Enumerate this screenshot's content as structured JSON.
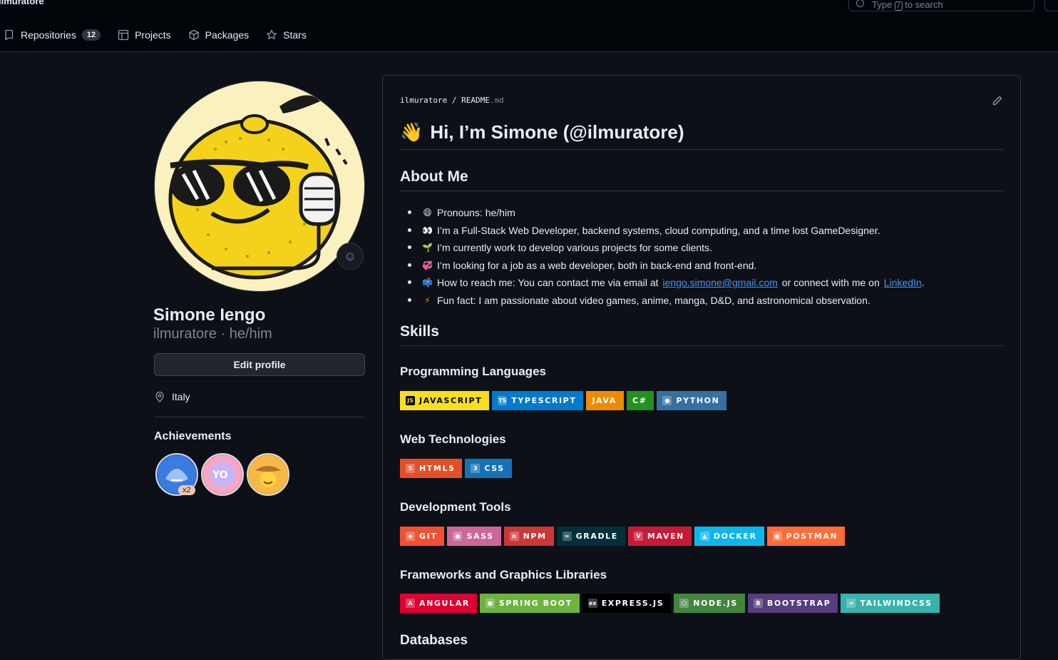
{
  "header": {
    "owner": "ilmuratore",
    "search_text": "Type / to search",
    "search_prefix": "Type",
    "search_key": "/",
    "search_suffix": "to search"
  },
  "nav": {
    "repositories": "Repositories",
    "repositories_count": "12",
    "projects": "Projects",
    "packages": "Packages",
    "stars": "Stars"
  },
  "profile": {
    "name": "Simone Iengo",
    "login_line": "ilmuratore · he/him",
    "edit_label": "Edit profile",
    "location": "Italy",
    "achievements_title": "Achievements",
    "achievement_count": "x2"
  },
  "readme": {
    "crumb_user": "ilmuratore",
    "crumb_sep": "/",
    "crumb_file": "README",
    "crumb_ext": ".md",
    "heading_emoji": "👋",
    "heading": "Hi, I’m Simone (@ilmuratore)",
    "about_title": "About Me",
    "about": [
      {
        "emoji": "😄",
        "text": "Pronouns: he/him"
      },
      {
        "emoji": "👀",
        "text": "I’m a Full-Stack Web Developer, backend systems, cloud computing, and a time lost GameDesigner."
      },
      {
        "emoji": "🌱",
        "text": "I’m currently work to develop various projects for some clients."
      },
      {
        "emoji": "💞️",
        "text": "I’m looking for a job as a web developer, both in back-end and front-end."
      },
      {
        "emoji": "📫",
        "text": "How to reach me: You can contact me via email at",
        "link1": "iengo.simone@gmail.com",
        "mid": "or connect with me on",
        "link2": "LinkedIn",
        "end": "."
      },
      {
        "emoji": "⚡",
        "text": "Fun fact: I am passionate about video games, anime, manga, D&D, and astronomical observation."
      }
    ],
    "skills_title": "Skills",
    "sections": [
      {
        "title": "Programming Languages",
        "badges": [
          {
            "label": "JAVASCRIPT",
            "bg": "#f7df1e",
            "fg": "#000000",
            "icon": "JS"
          },
          {
            "label": "TYPESCRIPT",
            "bg": "#007acc",
            "fg": "#ffffff",
            "icon": "TS"
          },
          {
            "label": "JAVA",
            "bg": "#ed8b00",
            "fg": "#ffffff",
            "icon": ""
          },
          {
            "label": "C#",
            "bg": "#239120",
            "fg": "#ffffff",
            "icon": ""
          },
          {
            "label": "PYTHON",
            "bg": "#3670a0",
            "fg": "#ffffff",
            "icon": "●"
          }
        ]
      },
      {
        "title": "Web Technologies",
        "badges": [
          {
            "label": "HTML5",
            "bg": "#e34f26",
            "fg": "#ffffff",
            "icon": "5"
          },
          {
            "label": "CSS",
            "bg": "#1572b6",
            "fg": "#ffffff",
            "icon": "3"
          }
        ]
      },
      {
        "title": "Development Tools",
        "badges": [
          {
            "label": "GIT",
            "bg": "#f05033",
            "fg": "#ffffff",
            "icon": "◆"
          },
          {
            "label": "SASS",
            "bg": "#cd6799",
            "fg": "#ffffff",
            "icon": "●"
          },
          {
            "label": "NPM",
            "bg": "#cb3837",
            "fg": "#ffffff",
            "icon": "n"
          },
          {
            "label": "GRADLE",
            "bg": "#02303a",
            "fg": "#ffffff",
            "icon": "≈"
          },
          {
            "label": "MAVEN",
            "bg": "#c71a36",
            "fg": "#ffffff",
            "icon": "V"
          },
          {
            "label": "DOCKER",
            "bg": "#0db7ed",
            "fg": "#ffffff",
            "icon": "▲"
          },
          {
            "label": "POSTMAN",
            "bg": "#ff6c37",
            "fg": "#ffffff",
            "icon": "●"
          }
        ]
      },
      {
        "title": "Frameworks and Graphics Libraries",
        "badges": [
          {
            "label": "ANGULAR",
            "bg": "#dd0031",
            "fg": "#ffffff",
            "icon": "A"
          },
          {
            "label": "SPRING BOOT",
            "bg": "#6db33f",
            "fg": "#ffffff",
            "icon": "●"
          },
          {
            "label": "EXPRESS.JS",
            "bg": "#000000",
            "fg": "#ffffff",
            "icon": "ex"
          },
          {
            "label": "NODE.JS",
            "bg": "#43853d",
            "fg": "#ffffff",
            "icon": "⬡"
          },
          {
            "label": "BOOTSTRAP",
            "bg": "#563d7c",
            "fg": "#ffffff",
            "icon": "B"
          },
          {
            "label": "TAILWINDCSS",
            "bg": "#38b2ac",
            "fg": "#ffffff",
            "icon": "≈"
          }
        ]
      }
    ],
    "next_title": "Databases"
  }
}
